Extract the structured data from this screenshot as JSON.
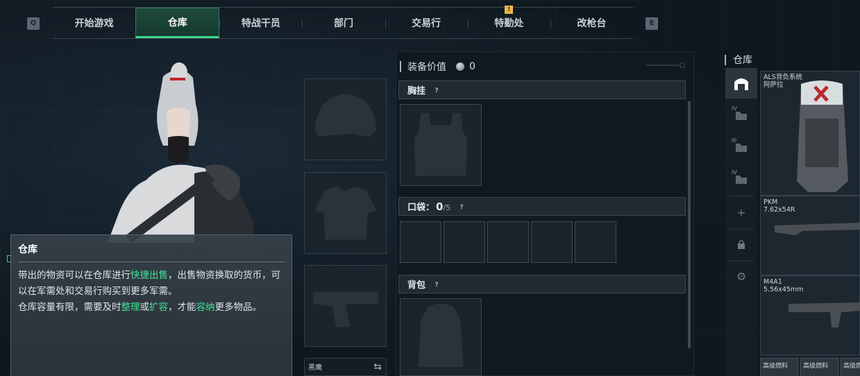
{
  "key_hints": {
    "left": "Q",
    "right": "E"
  },
  "nav": {
    "tabs": [
      {
        "label": "开始游戏",
        "active": false
      },
      {
        "label": "仓库",
        "active": true
      },
      {
        "label": "特战干员",
        "active": false
      },
      {
        "label": "部门",
        "active": false
      },
      {
        "label": "交易行",
        "active": false
      },
      {
        "label": "特勤处",
        "active": false,
        "badge": "!"
      },
      {
        "label": "改枪台",
        "active": false
      }
    ]
  },
  "tooltip": {
    "title": "仓库",
    "line1_a": "带出的物资可以在仓库进行",
    "line1_hl": "快捷出售",
    "line1_b": "，出售物资换取的货币，可以在军需处和交易行购买到更多军需。",
    "line2_a": "仓库容量有限，需要及时",
    "line2_hl1": "整理",
    "line2_b": "或",
    "line2_hl2": "扩容",
    "line2_c": "，才能",
    "line2_hl3": "容纳",
    "line2_d": "更多物品。"
  },
  "equipment": {
    "slots": [
      "helmet-slot",
      "armor-slot",
      "pistol-slot"
    ],
    "sidearm_label": "黑鹰",
    "value_label": "装备价值",
    "value": "0"
  },
  "sections": {
    "chest_rig": "胸挂",
    "pockets": "口袋：",
    "pockets_used": "0",
    "pockets_total": "/5",
    "backpack": "背包",
    "help_glyph": "?"
  },
  "warehouse": {
    "title": "仓库",
    "rail_tags": [
      "IV",
      "III",
      "IV"
    ],
    "items": [
      {
        "name": "ALS背负系统",
        "sub": "阿萨拉"
      },
      {
        "name": "PKM",
        "sub": "7.62x54R"
      },
      {
        "name": "M4A1",
        "sub": "5.56x45mm"
      }
    ],
    "minis": [
      "高级燃料",
      "高级燃料",
      "高级燃料"
    ]
  },
  "colors": {
    "accent": "#3fd48d",
    "highlight": "#42e39a",
    "badge": "#e7b64a"
  }
}
